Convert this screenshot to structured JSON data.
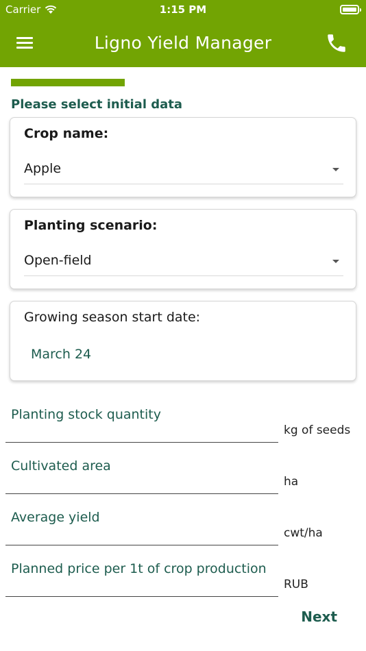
{
  "status_bar": {
    "carrier": "Carrier",
    "time": "1:15 PM"
  },
  "header": {
    "title": "Ligno Yield Manager",
    "icons": {
      "menu": "hamburger-menu-icon",
      "phone": "phone-icon"
    }
  },
  "progress": {
    "fraction": 0.33
  },
  "subtitle": "Please select initial data",
  "crop": {
    "label": "Crop name:",
    "value": "Apple"
  },
  "scenario": {
    "label": "Planting scenario:",
    "value": "Open-field"
  },
  "season": {
    "label": "Growing season start date:",
    "value": "March 24"
  },
  "fields": [
    {
      "placeholder": "Planting stock quantity",
      "unit": "kg of seeds"
    },
    {
      "placeholder": "Cultivated area",
      "unit": "ha"
    },
    {
      "placeholder": "Average yield",
      "unit": "cwt/ha"
    },
    {
      "placeholder": "Planned price per 1t of crop production",
      "unit": "RUB"
    }
  ],
  "next_label": "Next",
  "colors": {
    "brand_green": "#72a403",
    "text_teal": "#1d5c4e"
  }
}
